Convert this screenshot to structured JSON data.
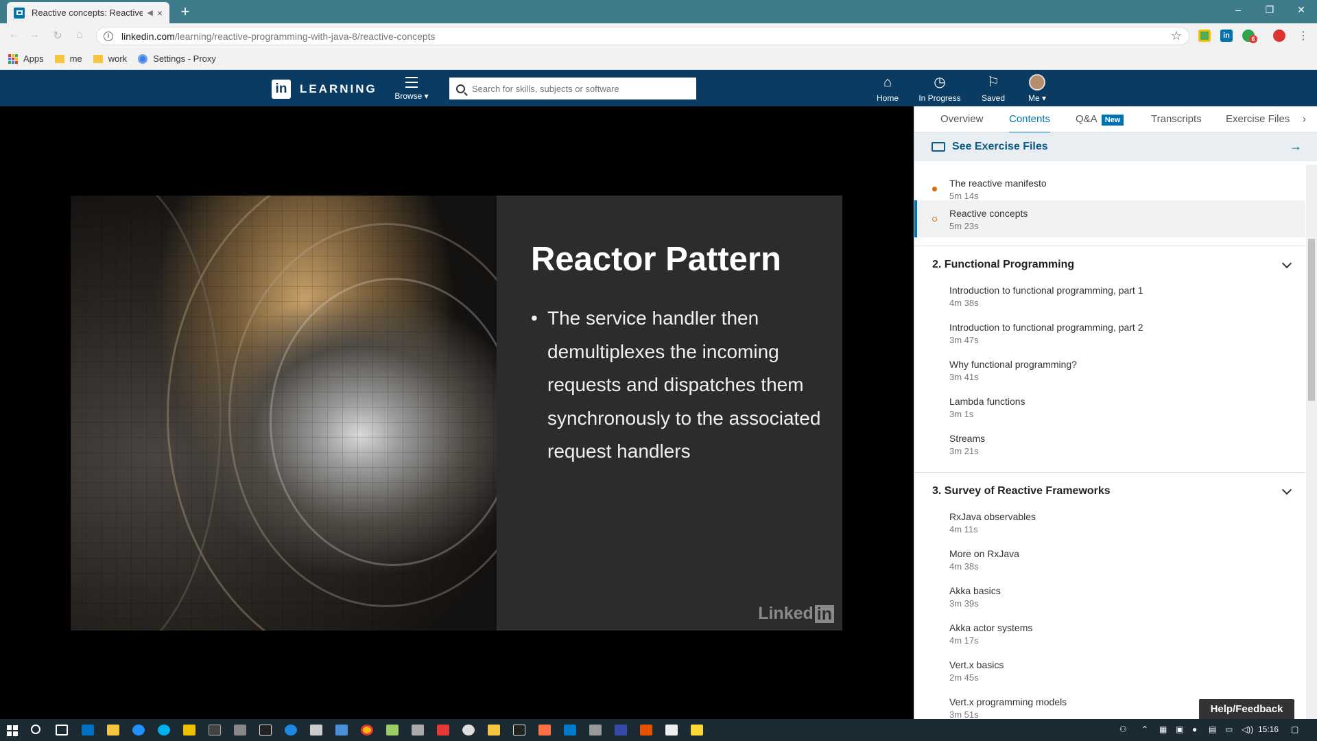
{
  "browser": {
    "tab_title": "Reactive concepts: Reactive P",
    "tab_audio": "◀",
    "tab_close": "×",
    "new_tab": "+",
    "url_host": "linkedin.com",
    "url_path": "/learning/reactive-programming-with-java-8/reactive-concepts",
    "window_controls": [
      "–",
      "❐",
      "✕"
    ],
    "extension_badges": [
      "6"
    ]
  },
  "bookmarks": [
    {
      "label": "Apps",
      "icon": "apps-icon"
    },
    {
      "label": "me",
      "icon": "folder-icon"
    },
    {
      "label": "work",
      "icon": "folder-icon"
    },
    {
      "label": "Settings - Proxy",
      "icon": "gear-icon"
    }
  ],
  "header": {
    "logo_in": "in",
    "logo_word": "LEARNING",
    "browse_label": "Browse ▾",
    "search_placeholder": "Search for skills, subjects or software",
    "nav": [
      {
        "label": "Home",
        "icon": "home-icon"
      },
      {
        "label": "In Progress",
        "icon": "clock-icon"
      },
      {
        "label": "Saved",
        "icon": "bookmark-icon"
      },
      {
        "label": "Me ▾",
        "icon": "avatar"
      }
    ]
  },
  "slide": {
    "title": "Reactor Pattern",
    "bullet": "The service handler then demultiplexes the incoming requests and dispatches them synchronously to the associated request handlers",
    "watermark_text": "Linked",
    "watermark_box": "in"
  },
  "sidebar": {
    "tabs": [
      "Overview",
      "Contents",
      "Q&A",
      "Transcripts",
      "Exercise Files"
    ],
    "active_tab": "Contents",
    "new_badge": "New",
    "exercise_files_label": "See Exercise Files",
    "lessons_top": [
      {
        "title": "The reactive manifesto",
        "duration": "5m 14s",
        "status": "watched"
      },
      {
        "title": "Reactive concepts",
        "duration": "5m 23s",
        "status": "current"
      }
    ],
    "sections": [
      {
        "title": "2. Functional Programming",
        "lessons": [
          {
            "title": "Introduction to functional programming, part 1",
            "duration": "4m 38s"
          },
          {
            "title": "Introduction to functional programming, part 2",
            "duration": "3m 47s"
          },
          {
            "title": "Why functional programming?",
            "duration": "3m 41s"
          },
          {
            "title": "Lambda functions",
            "duration": "3m 1s"
          },
          {
            "title": "Streams",
            "duration": "3m 21s"
          }
        ]
      },
      {
        "title": "3. Survey of Reactive Frameworks",
        "lessons": [
          {
            "title": "RxJava observables",
            "duration": "4m 11s"
          },
          {
            "title": "More on RxJava",
            "duration": "4m 38s"
          },
          {
            "title": "Akka basics",
            "duration": "3m 39s"
          },
          {
            "title": "Akka actor systems",
            "duration": "4m 17s"
          },
          {
            "title": "Vert.x basics",
            "duration": "2m 45s"
          },
          {
            "title": "Vert.x programming models",
            "duration": "3m 51s"
          }
        ]
      }
    ],
    "help_label": "Help/Feedback"
  },
  "taskbar": {
    "clock": "15:16"
  },
  "colors": {
    "tab_bar": "#3e7c8c",
    "linkedin_header": "#0a3c63",
    "accent": "#0073b1",
    "watched_dot": "#e06c00"
  }
}
